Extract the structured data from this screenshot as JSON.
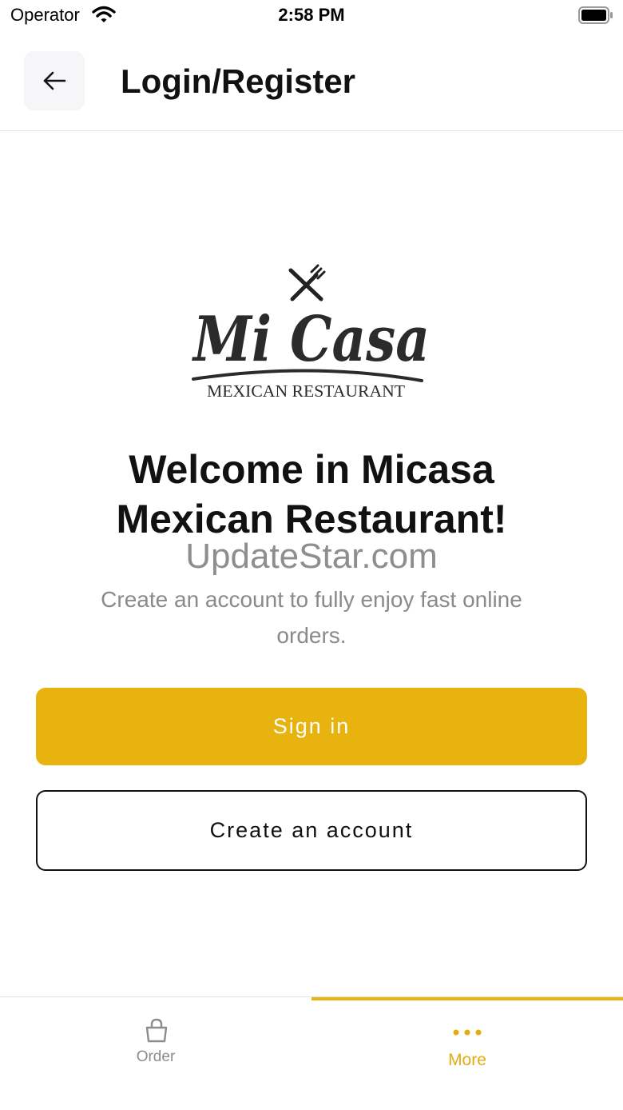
{
  "status_bar": {
    "carrier": "Operator",
    "time": "2:58 PM"
  },
  "header": {
    "title": "Login/Register",
    "back_icon": "arrow-left-icon"
  },
  "logo": {
    "script_text": "Mi Casa",
    "tagline": "MEXICAN RESTAURANT",
    "icon": "fork-knife-icon"
  },
  "welcome": {
    "title": "Welcome in Micasa Mexican Restaurant!",
    "watermark": "UpdateStar.com",
    "subtitle": "Create an account to fully enjoy fast online orders."
  },
  "buttons": {
    "sign_in": "Sign in",
    "create_account": "Create an account"
  },
  "tab_bar": {
    "tabs": [
      {
        "label": "Order",
        "icon": "shopping-bag-icon",
        "active": false
      },
      {
        "label": "More",
        "icon": "more-dots-icon",
        "active": true
      }
    ]
  },
  "colors": {
    "accent": "#e8b30f",
    "text_primary": "#111111",
    "text_secondary": "#8a8a8a"
  }
}
